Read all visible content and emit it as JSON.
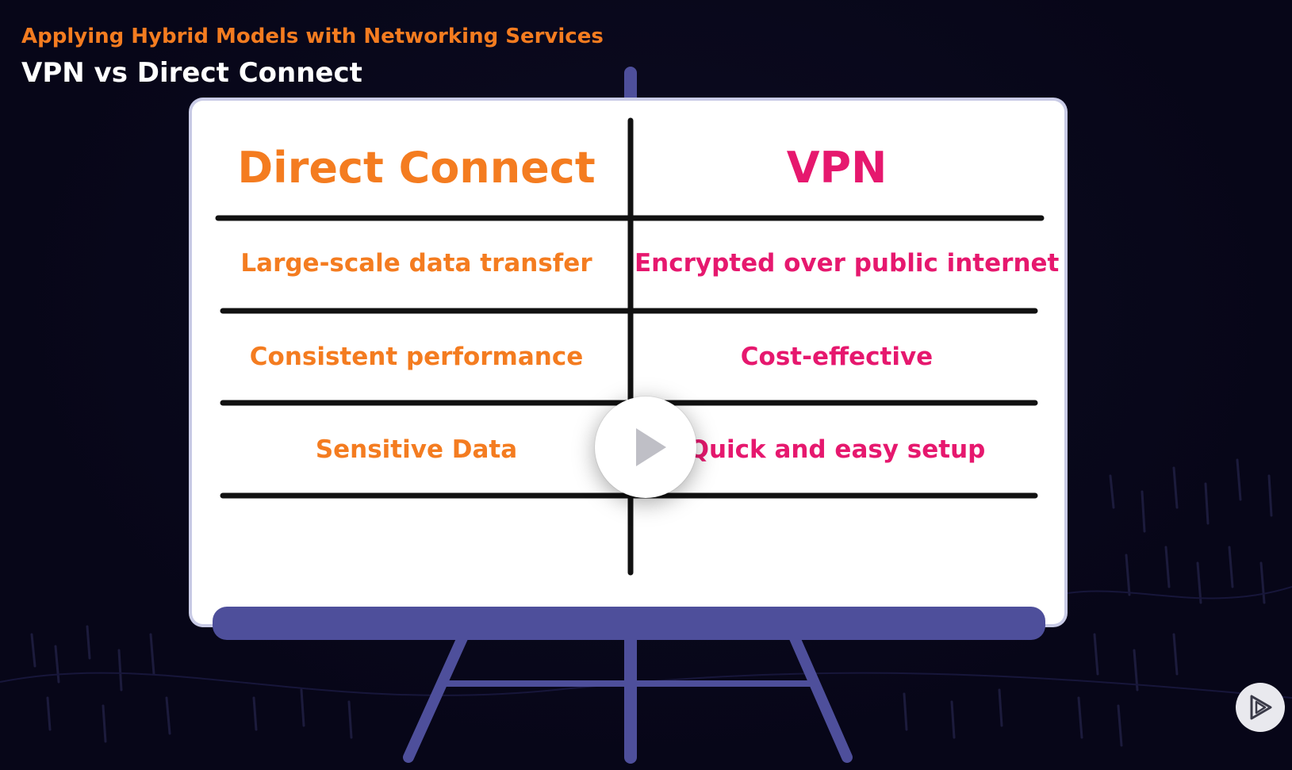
{
  "header": {
    "course_title": "Applying Hybrid Models with Networking Services",
    "clip_title": "VPN vs Direct Connect"
  },
  "comparison": {
    "left_heading": "Direct Connect",
    "right_heading": "VPN",
    "rows": [
      {
        "left": "Large-scale data transfer",
        "right": "Encrypted over public internet"
      },
      {
        "left": "Consistent performance",
        "right": "Cost-effective"
      },
      {
        "left": "Sensitive Data",
        "right": "Quick and easy setup"
      }
    ]
  },
  "icons": {
    "play": "play-icon",
    "brand": "pluralsight-logo-icon"
  },
  "colors": {
    "background": "#070618",
    "orange_accent": "#f47c20",
    "pink_accent": "#e6186e",
    "easel_blue": "#4e4f9b",
    "board": "#ffffff"
  }
}
